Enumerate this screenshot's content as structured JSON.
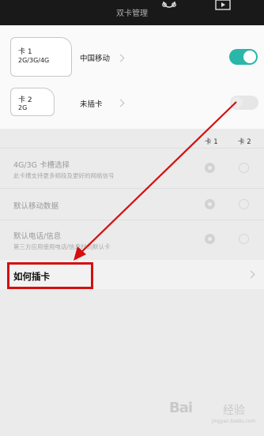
{
  "titlebar": {
    "title": "双卡管理"
  },
  "sim_cards": [
    {
      "name": "卡 1",
      "type": "2G/3G/4G",
      "carrier": "中国移动",
      "enabled": true
    },
    {
      "name": "卡 2",
      "type": "2G",
      "carrier": "未插卡",
      "enabled": false
    }
  ],
  "columns": [
    "卡 1",
    "卡 2"
  ],
  "options": [
    {
      "title": "4G/3G 卡槽选择",
      "subtitle": "此卡槽支持更多频段及更好的网络信号",
      "selected": "卡 1"
    },
    {
      "title": "默认移动数据",
      "subtitle": "",
      "selected": "卡 1"
    },
    {
      "title": "默认电话/信息",
      "subtitle": "第三方应用使用电话/信息时的默认卡",
      "selected": "卡 1"
    }
  ],
  "howto": {
    "label": "如何插卡"
  },
  "watermark": {
    "text": "Bai",
    "text2": "经验",
    "url": "jingyan.baidu.com"
  },
  "colors": {
    "accent": "#2ab6a8",
    "highlight": "#d40f0f"
  }
}
